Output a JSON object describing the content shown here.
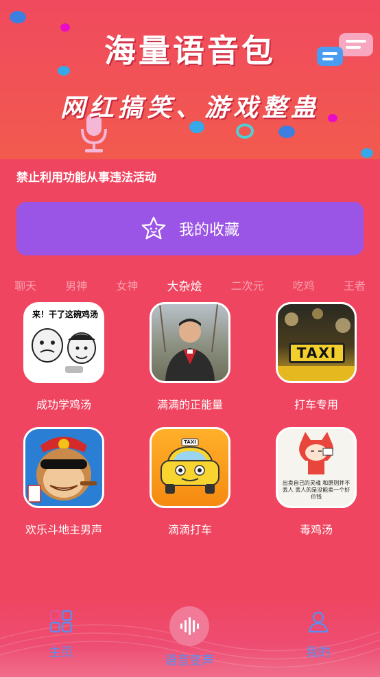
{
  "banner": {
    "title": "海量语音包",
    "subtitle": "网红搞笑、游戏整蛊"
  },
  "warning": "禁止利用功能从事违法活动",
  "favorites_button": {
    "label": "我的收藏",
    "icon": "star-face-icon"
  },
  "tabs": [
    {
      "label": "聊天",
      "active": false
    },
    {
      "label": "男神",
      "active": false
    },
    {
      "label": "女神",
      "active": false
    },
    {
      "label": "大杂烩",
      "active": true
    },
    {
      "label": "二次元",
      "active": false
    },
    {
      "label": "吃鸡",
      "active": false
    },
    {
      "label": "王者",
      "active": false
    }
  ],
  "items": [
    {
      "label": "成功学鸡汤",
      "thumb_text": "来！干了这碗鸡汤"
    },
    {
      "label": "满满的正能量",
      "thumb_text": ""
    },
    {
      "label": "打车专用",
      "thumb_text": "TAXI"
    },
    {
      "label": "欢乐斗地主男声",
      "thumb_text": ""
    },
    {
      "label": "滴滴打车",
      "thumb_text": "TAXI"
    },
    {
      "label": "毒鸡汤",
      "thumb_text": "出卖自己的灵魂 和原则并不丢人 丢人的是没能卖一个好价钱"
    }
  ],
  "nav": [
    {
      "label": "主页",
      "icon": "grid-icon",
      "color": "#5a8ef0"
    },
    {
      "label": "语音变声",
      "icon": "voice-wave-icon",
      "color": "#5a8ef0"
    },
    {
      "label": "我的",
      "icon": "user-icon",
      "color": "#5a8ef0"
    }
  ],
  "colors": {
    "accent": "#ef4560",
    "fav_button": "#9b55e6"
  }
}
